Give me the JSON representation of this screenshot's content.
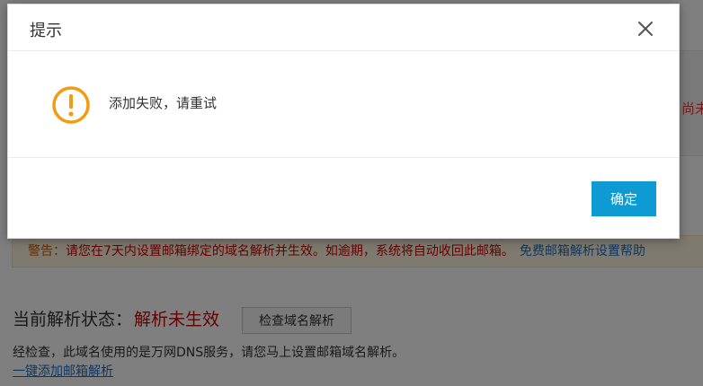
{
  "background": {
    "right_edge_text": "尚未",
    "warning": {
      "prefix": "警告：",
      "body": "请您在7天内设置邮箱绑定的域名解析并生效。如逾期，系统将自动收回此邮箱。",
      "link": "免费邮箱解析设置帮助"
    },
    "status": {
      "label": "当前解析状态：",
      "value": "解析未生效",
      "check_button": "检查域名解析"
    },
    "note": "经检查，此域名使用的是万网DNS服务，请您马上设置邮箱域名解析。",
    "one_click_link": "一键添加邮箱解析"
  },
  "dialog": {
    "title": "提示",
    "message": "添加失败，请重试",
    "ok_label": "确定",
    "icons": {
      "close": "close-icon",
      "warning": "warning-icon"
    },
    "colors": {
      "accent": "#0e9bd3",
      "warning_icon": "#f39c12",
      "alert_red": "#d00000"
    }
  }
}
